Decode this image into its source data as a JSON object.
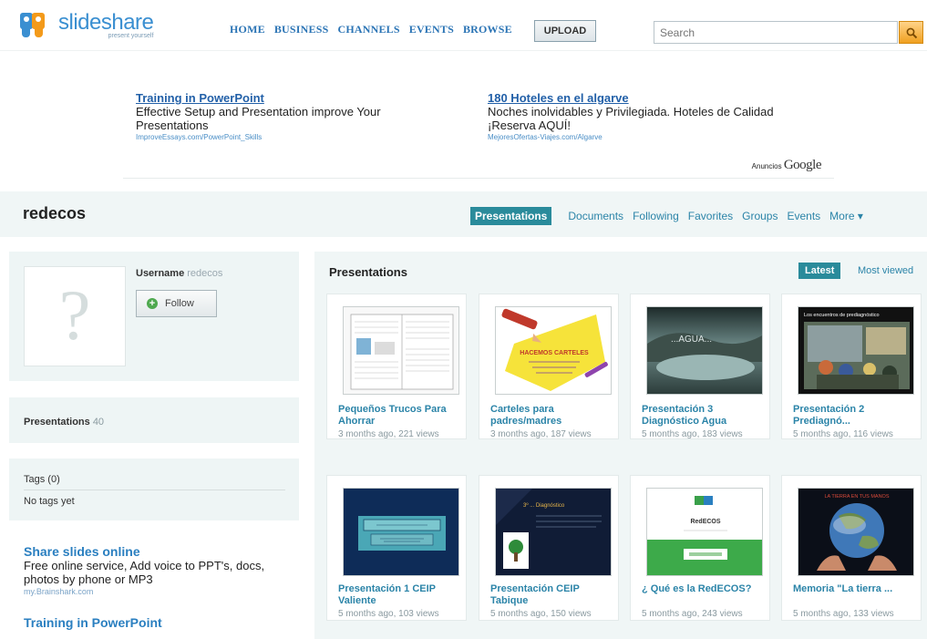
{
  "header": {
    "logo_name": "slideshare",
    "logo_tagline": "present yourself",
    "nav": [
      "HOME",
      "BUSINESS",
      "CHANNELS",
      "EVENTS",
      "BROWSE"
    ],
    "upload_label": "UPLOAD",
    "search_placeholder": "Search",
    "search_icon": "search-icon",
    "colors": {
      "brand_blue": "#3a8fd1",
      "brand_orange": "#f39a1a",
      "accent_teal": "#2a8b9b"
    }
  },
  "ads": {
    "items": [
      {
        "title": "Training in PowerPoint",
        "body": "Effective Setup and Presentation improve Your Presentations",
        "url": "ImproveEssays.com/PowerPoint_Skills"
      },
      {
        "title": "180 Hoteles en el algarve",
        "body": "Noches inolvidables y Privilegiada. Hoteles de Calidad ¡Reserva AQUÍ!",
        "url": "MejoresOfertas-Viajes.com/Algarve"
      }
    ],
    "by_label": "Anuncios",
    "by_brand": "Google"
  },
  "user": {
    "name": "redecos",
    "tabs": [
      "Presentations",
      "Documents",
      "Following",
      "Favorites",
      "Groups",
      "Events",
      "More ▾"
    ],
    "active_tab": "Presentations"
  },
  "sidebar": {
    "username_label": "Username",
    "username_value": "redecos",
    "follow_label": "Follow",
    "presentations_label": "Presentations",
    "presentations_count": "40",
    "tags_label": "Tags (0)",
    "tags_empty": "No tags yet",
    "ads": [
      {
        "title": "Share slides online",
        "body": "Free online service, Add voice to PPT's, docs, photos by phone or MP3",
        "url": "my.Brainshark.com"
      },
      {
        "title": "Training in PowerPoint",
        "body": "",
        "url": ""
      }
    ]
  },
  "main": {
    "title": "Presentations",
    "sort_latest": "Latest",
    "sort_most_viewed": "Most viewed",
    "presentations": [
      {
        "title": "Pequeños Trucos Para Ahorrar",
        "meta": "3 months ago, 221 views"
      },
      {
        "title": "Carteles para padres/madres",
        "meta": "3 months ago, 187 views"
      },
      {
        "title": "Presentación 3 Diagnóstico Agua",
        "meta": "5 months ago, 183 views"
      },
      {
        "title": "Presentación 2 Prediagnó...",
        "meta": "5 months ago, 116 views"
      },
      {
        "title": "Presentación 1 CEIP Valiente",
        "meta": "5 months ago, 103 views"
      },
      {
        "title": "Presentación CEIP Tabique",
        "meta": "5 months ago, 150 views"
      },
      {
        "title": "¿ Qué es la RedECOS?",
        "meta": "5 months ago, 243 views"
      },
      {
        "title": "Memoria \"La tierra ...",
        "meta": "5 months ago, 133 views"
      }
    ],
    "thumbs": {
      "t3_overlay": "...AGUA...",
      "t4_caption": "Los encuentros de prediagnóstico",
      "t2_caption": "HACEMOS CARTELES",
      "t6_caption": "3º ... Diagnóstico",
      "t7_caption": "RedECOS",
      "t8_caption": "LA TIERRA EN TUS MANOS"
    }
  }
}
